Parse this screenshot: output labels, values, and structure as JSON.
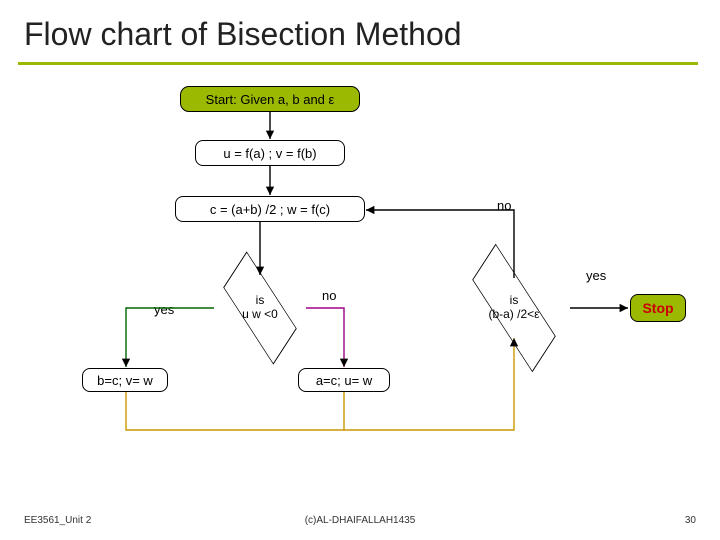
{
  "title": "Flow chart of Bisection Method",
  "nodes": {
    "start": "Start: Given  a, b  and ε",
    "calc1": "u = f(a) ; v = f(b)",
    "calc2": "c = (a+b) /2 ; w = f(c)",
    "dec1_l1": "is",
    "dec1_l2": "u w <0",
    "dec2_l1": "is",
    "dec2_l2": "(b-a) /2<ε",
    "upd_left": "b=c; v= w",
    "upd_right": "a=c; u= w",
    "stop": "Stop"
  },
  "labels": {
    "yes": "yes",
    "no": "no"
  },
  "footer": {
    "left": "EE3561_Unit 2",
    "center": "(c)AL-DHAIFALLAH1435",
    "right": "30"
  },
  "chart_data": {
    "type": "flowchart",
    "title": "Flow chart of Bisection Method",
    "nodes": [
      {
        "id": "start",
        "kind": "terminator",
        "text": "Start: Given a, b and ε"
      },
      {
        "id": "uv",
        "kind": "process",
        "text": "u = f(a) ; v = f(b)"
      },
      {
        "id": "cw",
        "kind": "process",
        "text": "c = (a+b)/2 ; w = f(c)"
      },
      {
        "id": "sign",
        "kind": "decision",
        "text": "is u·w < 0"
      },
      {
        "id": "tol",
        "kind": "decision",
        "text": "is (b-a)/2 < ε"
      },
      {
        "id": "left",
        "kind": "process",
        "text": "b = c ; v = w"
      },
      {
        "id": "right",
        "kind": "process",
        "text": "a = c ; u = w"
      },
      {
        "id": "stop",
        "kind": "terminator",
        "text": "Stop"
      }
    ],
    "edges": [
      {
        "from": "start",
        "to": "uv"
      },
      {
        "from": "uv",
        "to": "cw"
      },
      {
        "from": "cw",
        "to": "sign"
      },
      {
        "from": "sign",
        "to": "left",
        "label": "yes"
      },
      {
        "from": "sign",
        "to": "right",
        "label": "no"
      },
      {
        "from": "left",
        "to": "tol"
      },
      {
        "from": "right",
        "to": "tol"
      },
      {
        "from": "tol",
        "to": "cw",
        "label": "no"
      },
      {
        "from": "tol",
        "to": "stop",
        "label": "yes"
      }
    ]
  }
}
